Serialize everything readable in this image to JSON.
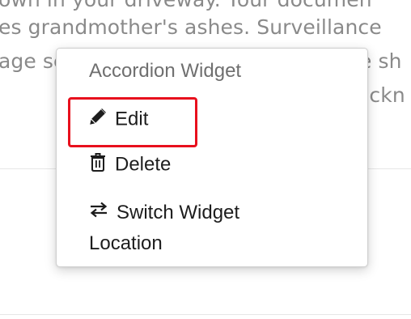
{
  "background": {
    "lines": [
      "own in your driveway. Your documen",
      "es grandmother's ashes. Surveillance",
      "age se",
      "ge sh",
      "ackn"
    ]
  },
  "menu": {
    "header": "Accordion Widget",
    "items": [
      {
        "label": "Edit",
        "icon": "pencil-icon"
      },
      {
        "label": "Delete",
        "icon": "trash-icon"
      },
      {
        "label": "Switch Widget Location",
        "icon": "swap-arrows-icon"
      }
    ]
  },
  "colors": {
    "highlight_border": "#e8101d",
    "menu_text": "#1d1d1d",
    "header_text": "#6f6f6f",
    "background_text": "#8a8a8a"
  }
}
